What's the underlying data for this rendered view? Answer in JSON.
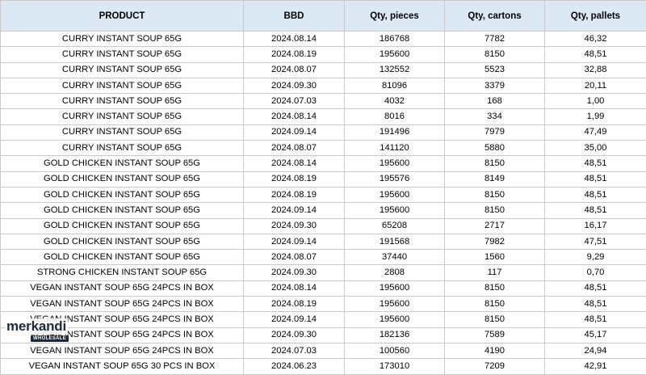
{
  "columns": [
    "PRODUCT",
    "BBD",
    "Qty, pieces",
    "Qty, cartons",
    "Qty, pallets"
  ],
  "rows": [
    [
      "CURRY INSTANT SOUP 65G",
      "2024.08.14",
      "186768",
      "7782",
      "46,32"
    ],
    [
      "CURRY INSTANT SOUP 65G",
      "2024.08.19",
      "195600",
      "8150",
      "48,51"
    ],
    [
      "CURRY INSTANT SOUP 65G",
      "2024.08.07",
      "132552",
      "5523",
      "32,88"
    ],
    [
      "CURRY INSTANT SOUP 65G",
      "2024.09.30",
      "81096",
      "3379",
      "20,11"
    ],
    [
      "CURRY INSTANT SOUP 65G",
      "2024.07.03",
      "4032",
      "168",
      "1,00"
    ],
    [
      "CURRY INSTANT SOUP 65G",
      "2024.08.14",
      "8016",
      "334",
      "1,99"
    ],
    [
      "CURRY INSTANT SOUP 65G",
      "2024.09.14",
      "191496",
      "7979",
      "47,49"
    ],
    [
      "CURRY INSTANT SOUP 65G",
      "2024.08.07",
      "141120",
      "5880",
      "35,00"
    ],
    [
      "GOLD CHICKEN INSTANT SOUP 65G",
      "2024.08.14",
      "195600",
      "8150",
      "48,51"
    ],
    [
      "GOLD CHICKEN INSTANT SOUP 65G",
      "2024.08.19",
      "195576",
      "8149",
      "48,51"
    ],
    [
      "GOLD CHICKEN INSTANT SOUP 65G",
      "2024.08.19",
      "195600",
      "8150",
      "48,51"
    ],
    [
      "GOLD CHICKEN INSTANT SOUP 65G",
      "2024.09.14",
      "195600",
      "8150",
      "48,51"
    ],
    [
      "GOLD CHICKEN INSTANT SOUP 65G",
      "2024.09.30",
      "65208",
      "2717",
      "16,17"
    ],
    [
      "GOLD CHICKEN INSTANT SOUP 65G",
      "2024.09.14",
      "191568",
      "7982",
      "47,51"
    ],
    [
      "GOLD CHICKEN INSTANT SOUP 65G",
      "2024.08.07",
      "37440",
      "1560",
      "9,29"
    ],
    [
      "STRONG CHICKEN INSTANT SOUP 65G",
      "2024.09.30",
      "2808",
      "117",
      "0,70"
    ],
    [
      "VEGAN INSTANT SOUP 65G 24PCS IN BOX",
      "2024.08.14",
      "195600",
      "8150",
      "48,51"
    ],
    [
      "VEGAN INSTANT SOUP 65G 24PCS IN BOX",
      "2024.08.19",
      "195600",
      "8150",
      "48,51"
    ],
    [
      "VEGAN INSTANT SOUP 65G 24PCS IN BOX",
      "2024.09.14",
      "195600",
      "8150",
      "48,51"
    ],
    [
      "VEGAN INSTANT SOUP 65G 24PCS IN BOX",
      "2024.09.30",
      "182136",
      "7589",
      "45,17"
    ],
    [
      "VEGAN INSTANT SOUP 65G 24PCS IN BOX",
      "2024.07.03",
      "100560",
      "4190",
      "24,94"
    ],
    [
      "VEGAN INSTANT SOUP 65G 30 PCS IN BOX",
      "2024.06.23",
      "173010",
      "7209",
      "42,91"
    ]
  ],
  "watermark": {
    "brand": "merkandi",
    "badge": "WHOLESALE"
  }
}
